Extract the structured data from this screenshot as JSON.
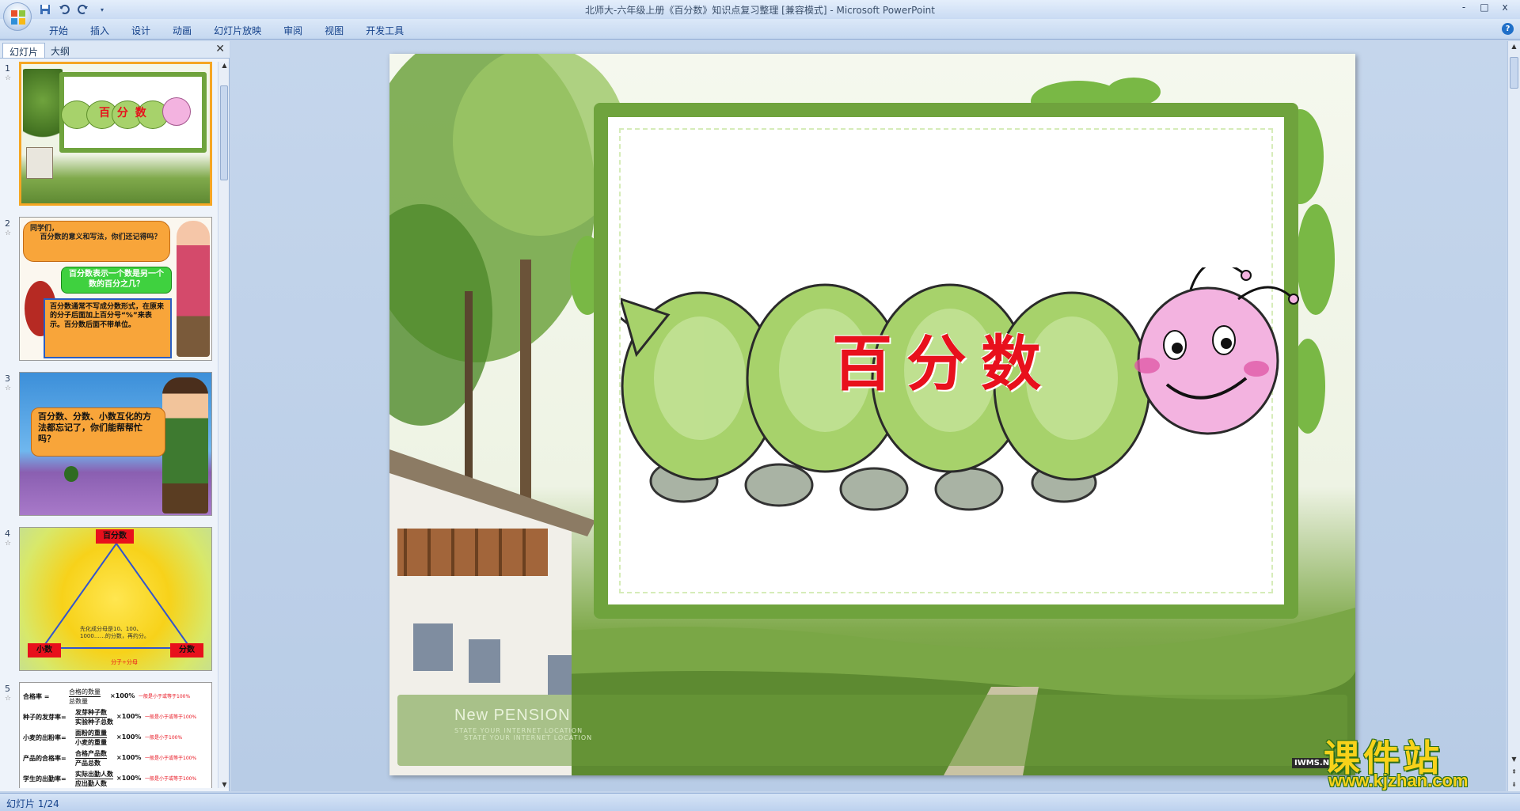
{
  "window": {
    "title": "北师大-六年级上册《百分数》知识点复习整理 [兼容模式] - Microsoft PowerPoint",
    "controls": [
      "-",
      "□",
      "x"
    ]
  },
  "quick_access": {
    "icons": [
      "save-icon",
      "undo-icon",
      "redo-icon",
      "customize-icon"
    ]
  },
  "ribbon": {
    "tabs": [
      "开始",
      "插入",
      "设计",
      "动画",
      "幻灯片放映",
      "审阅",
      "视图",
      "开发工具"
    ],
    "help": "?"
  },
  "slide_pane": {
    "tabs": [
      "幻灯片",
      "大纲"
    ],
    "close": "✕",
    "thumbnails": [
      {
        "num": "1",
        "title": "百 分 数"
      },
      {
        "num": "2",
        "bubble1": "同学们，\n    百分数的意义和写法，你们还记得吗？",
        "bubble2": "百分数表示一个数是另一个数的百分之几？",
        "bubble3": "百分数通常不写成分数形式，在原来的分子后面加上百分号“%”来表示。百分数后面不带单位。"
      },
      {
        "num": "3",
        "bubble": "百分数、分数、小数互化的方法都忘记了，你们能帮帮忙吗？"
      },
      {
        "num": "4",
        "top": "百分数",
        "left": "小数",
        "right": "分数",
        "middle": "先化成分母是10、100、1000……的分数，再约分。",
        "bottom": "分子÷分母"
      },
      {
        "num": "5",
        "rows": [
          {
            "label": "合格率 =",
            "num": "合格的数量",
            "den": "总数量",
            "tail": "×100%",
            "note": "一般是小于或等于100%"
          },
          {
            "label": "种子的发芽率=",
            "num": "发芽种子数",
            "den": "实验种子总数",
            "tail": "×100%",
            "note": "一般是小于或等于100%"
          },
          {
            "label": "小麦的出粉率=",
            "num": "面粉的重量",
            "den": "小麦的重量",
            "tail": "×100%",
            "note": "一般是小于100%"
          },
          {
            "label": "产品的合格率=",
            "num": "合格产品数",
            "den": "产品总数",
            "tail": "×100%",
            "note": "一般是小于或等于100%"
          },
          {
            "label": "学生的出勤率=",
            "num": "实际出勤人数",
            "den": "应出勤人数",
            "tail": "×100%",
            "note": "一般是小于或等于100%"
          }
        ]
      }
    ]
  },
  "slide": {
    "title": "百分数",
    "brand": "New PENSION",
    "tagline1": "STATE YOUR INTERNET LOCATION",
    "tagline2": "STATE YOUR INTERNET LOCATION",
    "corner_mark": "IWMS.NET"
  },
  "watermark": {
    "title": "课件站",
    "url": "www.kjzhan.com"
  },
  "statusbar": {
    "slide_info": "幻灯片 1/24"
  },
  "colors": {
    "accent": "#f5a623",
    "frame_green": "#6fa33d",
    "title_red": "#e8101c"
  }
}
